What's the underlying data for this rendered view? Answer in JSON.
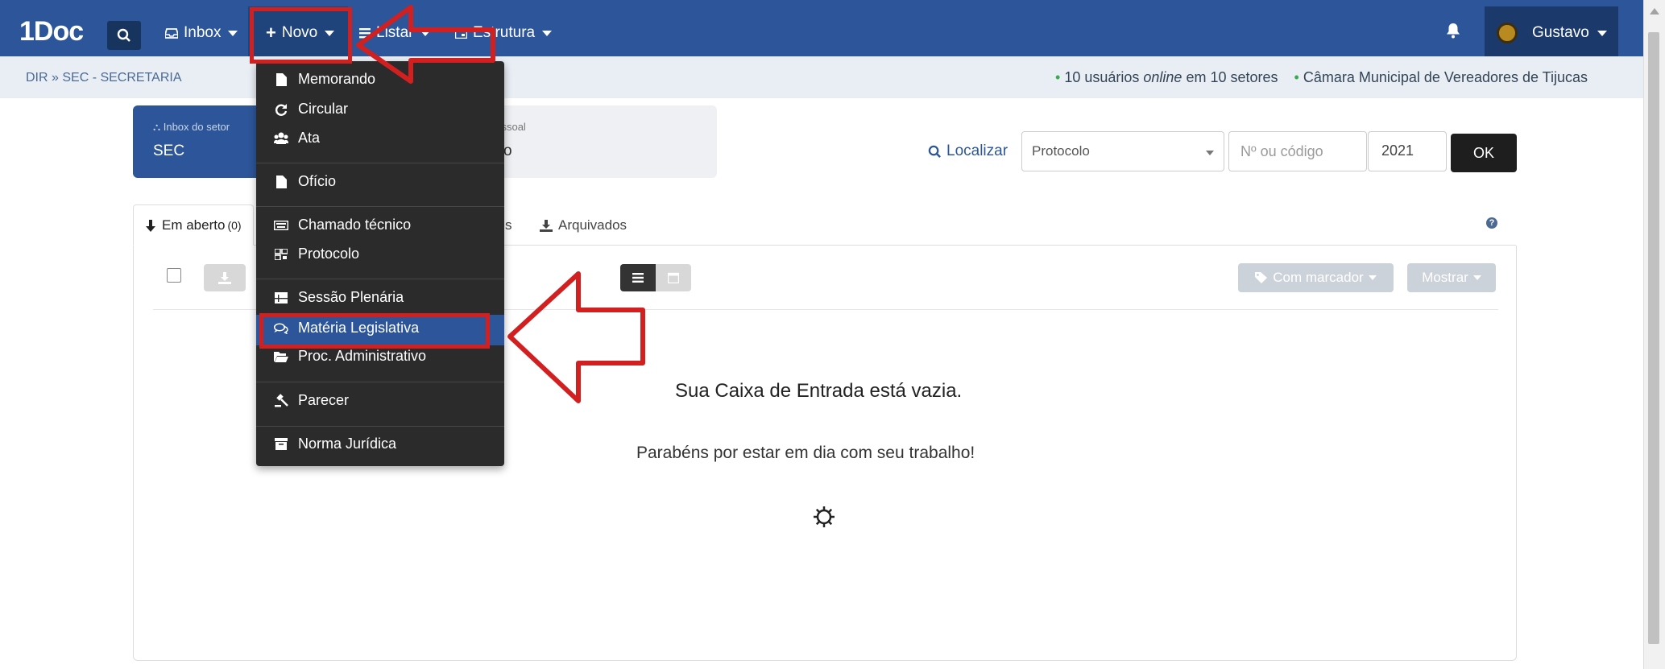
{
  "topbar": {
    "logo": "1Doc",
    "nav": [
      {
        "label": "Inbox"
      },
      {
        "label": "Novo"
      },
      {
        "label": "Listar"
      },
      {
        "label": "Estrutura"
      }
    ],
    "user": {
      "name": "Gustavo"
    }
  },
  "subbar": {
    "breadcrumb": "DIR » SEC - SECRETARIA",
    "online_users_prefix": "10 usuários ",
    "online_word": "online",
    "online_users_suffix": " em 10 setores",
    "organization": "Câmara Municipal de Vereadores de Tijucas"
  },
  "cards": {
    "sector_label": "Inbox do setor",
    "sector_value": "SEC",
    "personal_label": "pessoal",
    "personal_value": "o"
  },
  "search": {
    "label": "Localizar",
    "type_value": "Protocolo",
    "code_placeholder": "Nº ou código",
    "year": "2021",
    "submit": "OK"
  },
  "tabs": [
    {
      "label": "Em aberto",
      "count": "(0)"
    },
    {
      "label": "s"
    },
    {
      "label": "Arquivados"
    }
  ],
  "toolbar": {
    "tag_filter": "Com marcador",
    "show": "Mostrar"
  },
  "empty_state": {
    "title": "Sua Caixa de Entrada está vazia.",
    "subtitle": "Parabéns por estar em dia com seu trabalho!"
  },
  "novo_menu": {
    "items": [
      {
        "label": "Memorando",
        "icon": "file-icon"
      },
      {
        "label": "Circular",
        "icon": "refresh-icon"
      },
      {
        "label": "Ata",
        "icon": "users-icon"
      },
      {
        "label": "Ofício",
        "icon": "file-icon"
      },
      {
        "label": "Chamado técnico",
        "icon": "keyboard-icon"
      },
      {
        "label": "Protocolo",
        "icon": "barcode-icon"
      },
      {
        "label": "Sessão Plenária",
        "icon": "list-icon"
      },
      {
        "label": "Matéria Legislativa",
        "icon": "comments-icon"
      },
      {
        "label": "Proc. Administrativo",
        "icon": "folder-open-icon"
      },
      {
        "label": "Parecer",
        "icon": "gavel-icon"
      },
      {
        "label": "Norma Jurídica",
        "icon": "archive-icon"
      }
    ],
    "highlighted": "Matéria Legislativa"
  },
  "colors": {
    "brand": "#2c5699",
    "annotation": "#d21f1f",
    "menu_bg": "#2b2b2b"
  }
}
